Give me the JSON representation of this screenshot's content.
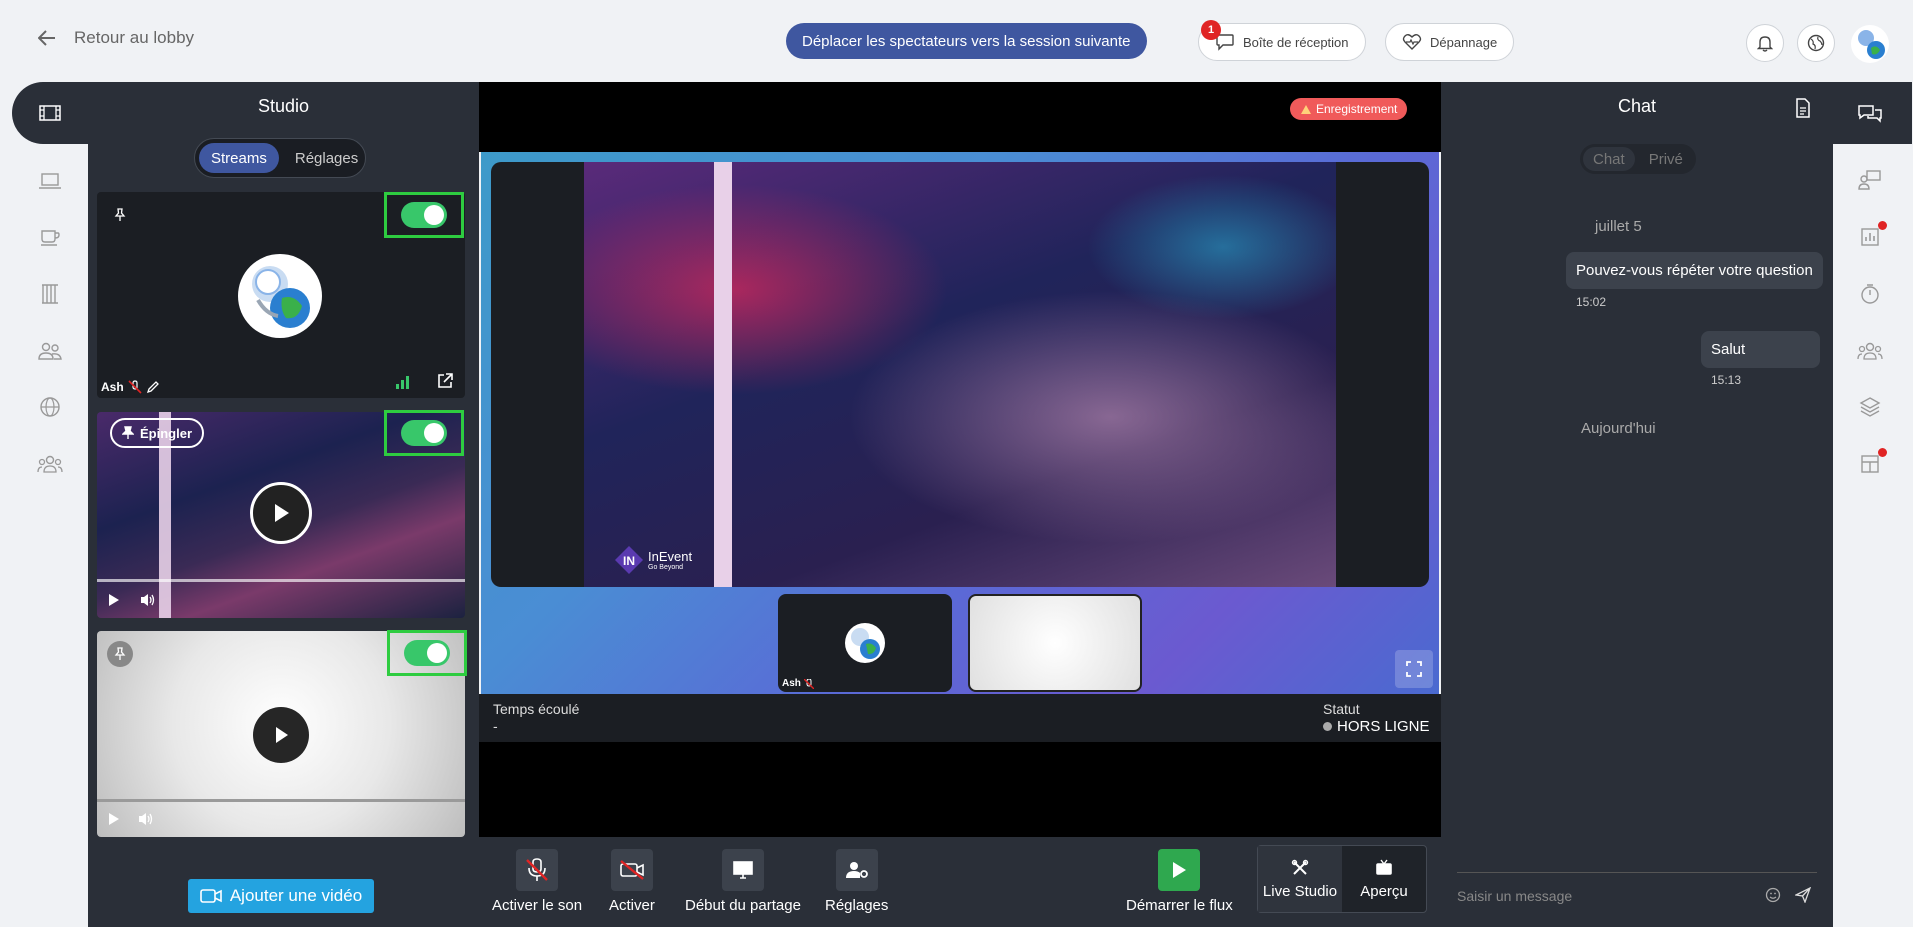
{
  "header": {
    "back_label": "Retour au lobby",
    "move_button": "Déplacer les spectateurs vers la session suivante",
    "inbox_label": "Boîte de réception",
    "inbox_badge": "1",
    "troubleshoot_label": "Dépannage"
  },
  "studio": {
    "title": "Studio",
    "tabs": [
      {
        "label": "Streams",
        "active": true
      },
      {
        "label": "Réglages",
        "active": false
      }
    ],
    "cards": [
      {
        "type": "camera",
        "user": "Ash",
        "enabled": true
      },
      {
        "type": "video",
        "pin_label": "Épingler",
        "enabled": true
      },
      {
        "type": "video",
        "enabled": true
      }
    ],
    "add_video": "Ajouter une vidéo"
  },
  "stage": {
    "recording_label": "Enregistrement",
    "logo_text": "InEvent",
    "logo_sub": "Go Beyond",
    "thumb_user": "Ash",
    "elapsed_label": "Temps écoulé",
    "elapsed_value": "-",
    "status_label": "Statut",
    "status_value": "HORS LIGNE"
  },
  "controls": {
    "unmute": "Activer le son",
    "camera": "Activer",
    "share": "Début du partage",
    "settings": "Réglages",
    "start": "Démarrer le flux",
    "live_studio": "Live Studio",
    "preview": "Aperçu"
  },
  "chat": {
    "title": "Chat",
    "tabs": [
      {
        "label": "Chat",
        "active": true
      },
      {
        "label": "Privé",
        "active": false
      }
    ],
    "date1": "juillet 5",
    "messages": [
      {
        "text": "Pouvez-vous répéter votre question",
        "time": "15:02"
      },
      {
        "text": "Salut",
        "time": "15:13"
      }
    ],
    "date2": "Aujourd'hui",
    "input_placeholder": "Saisir un message"
  },
  "colors": {
    "accent": "#3f57a0",
    "toggle_on": "#38c76a",
    "highlight": "#2ecc40",
    "recording": "#f05a5a",
    "panel_bg": "#2a2f38"
  }
}
